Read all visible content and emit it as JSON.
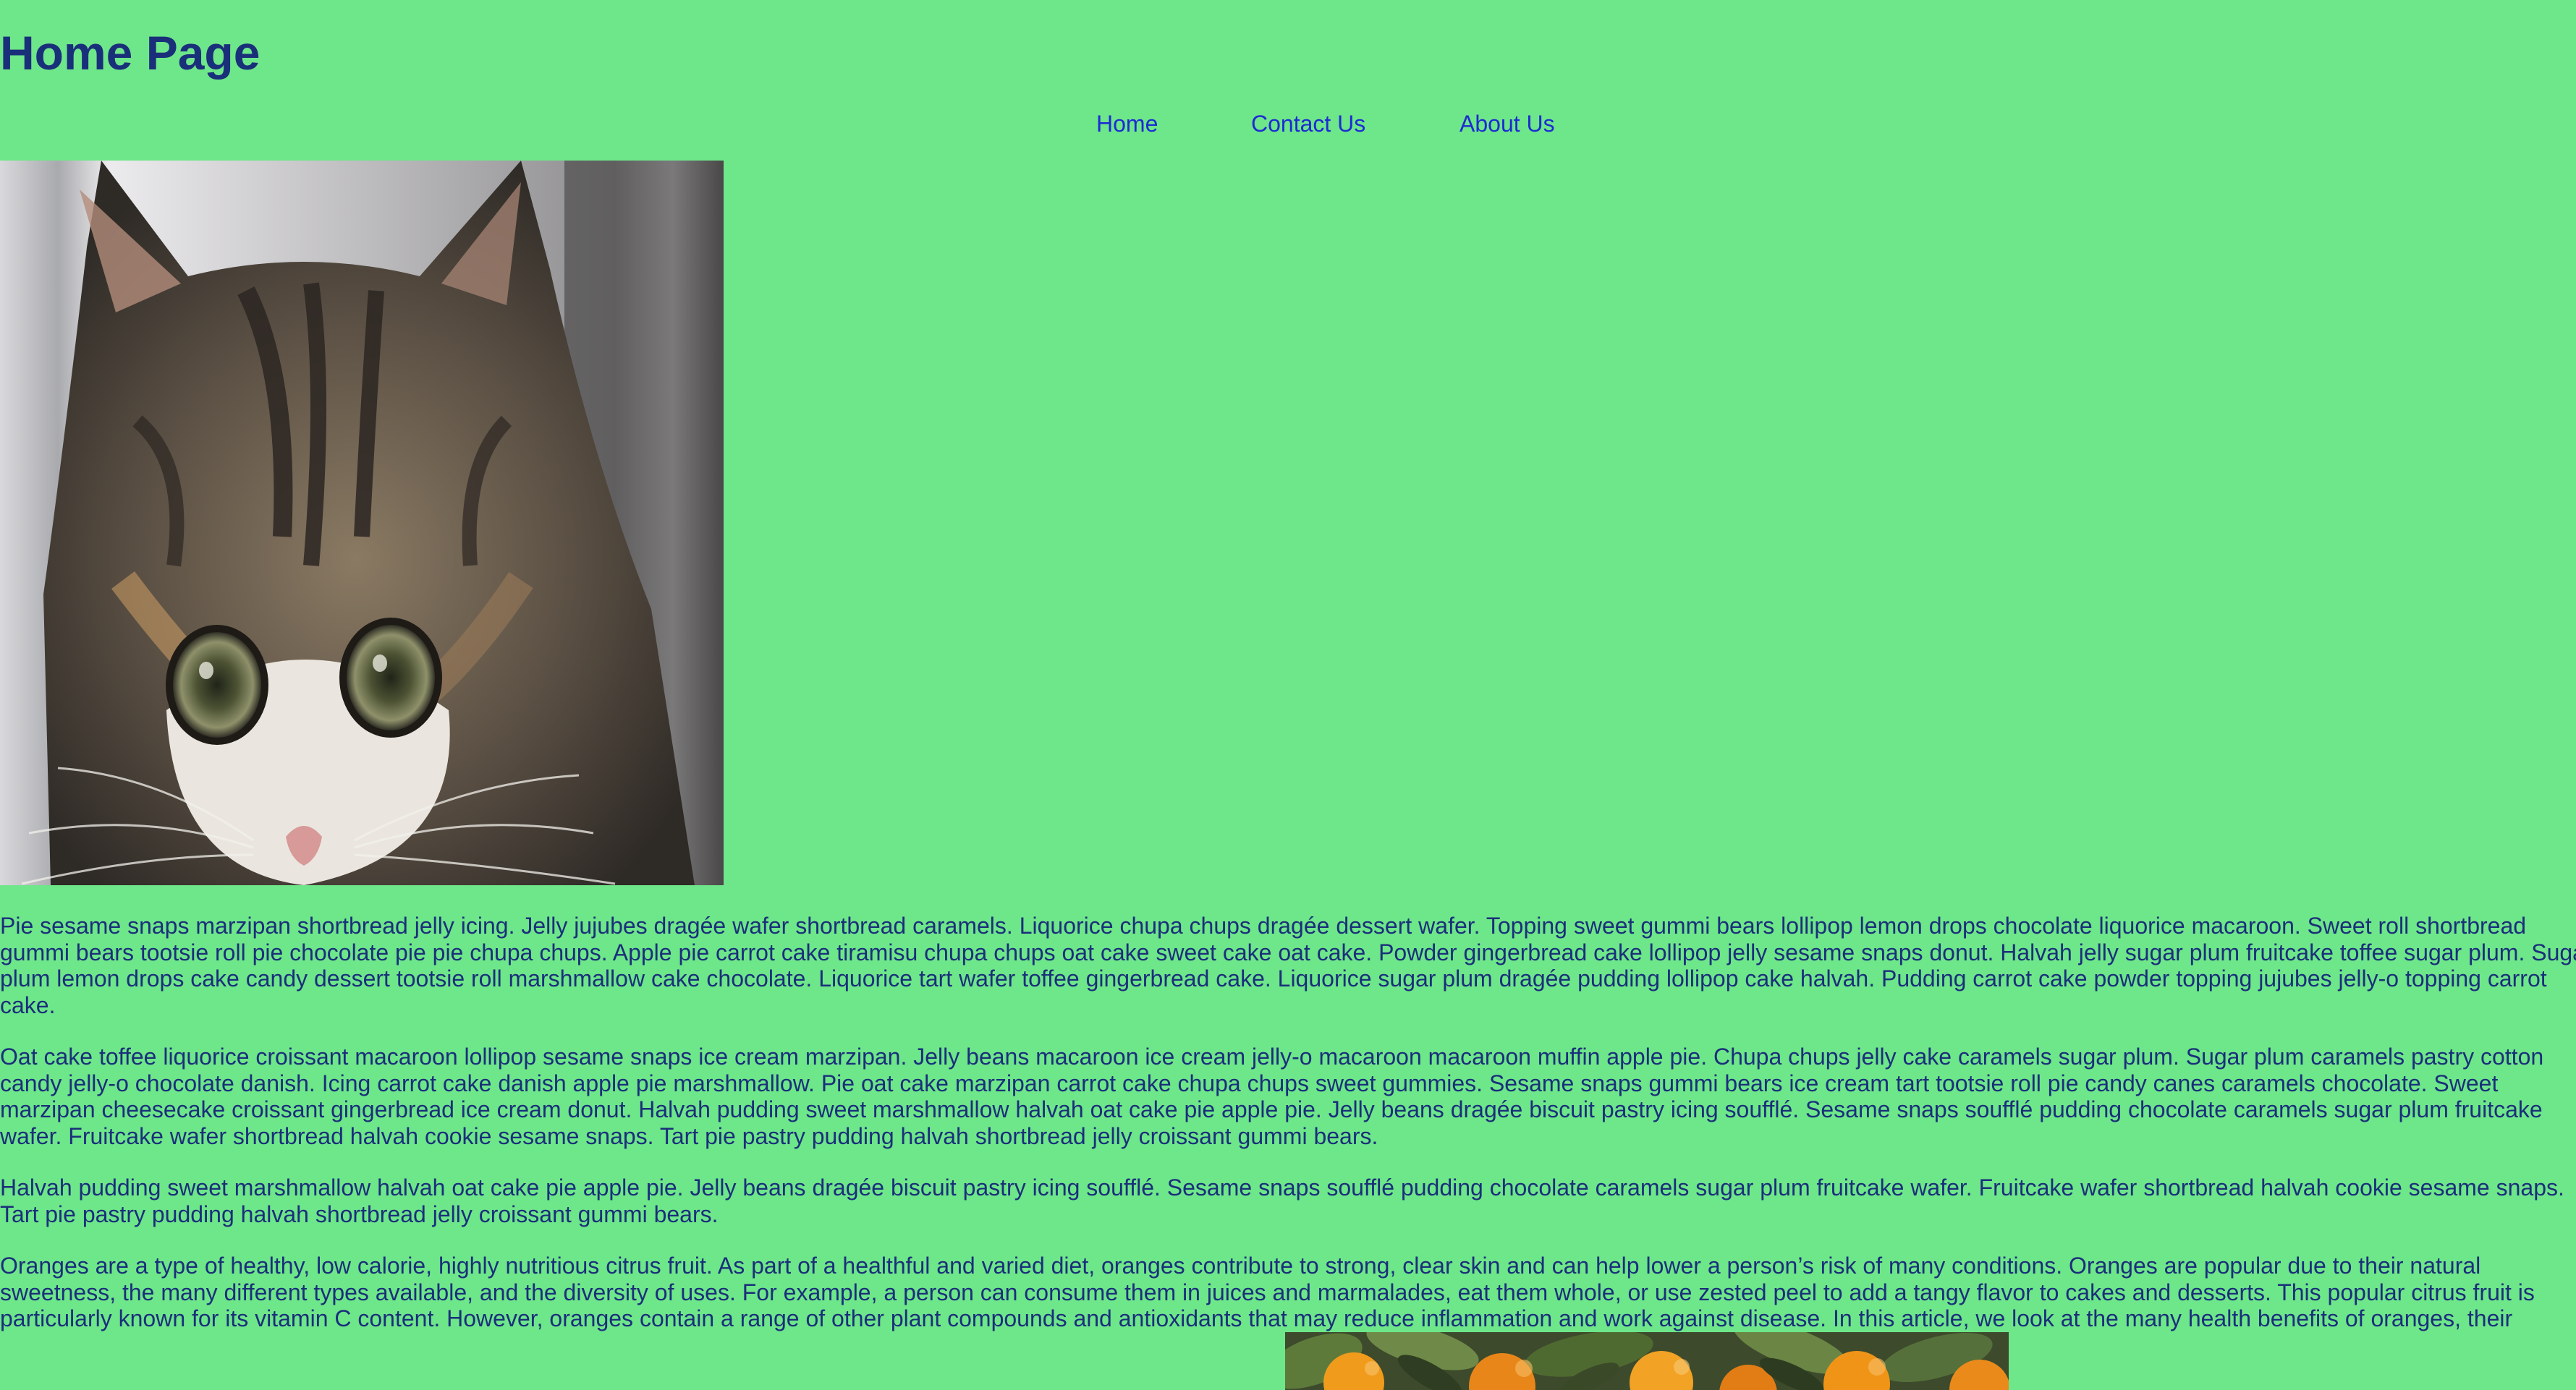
{
  "page": {
    "title": "Home Page"
  },
  "nav": {
    "items": [
      {
        "label": "Home"
      },
      {
        "label": "Contact Us"
      },
      {
        "label": "About Us"
      }
    ]
  },
  "images": {
    "cat": {
      "subject": "tabby kitten"
    },
    "oranges": {
      "subject": "oranges with leaves"
    }
  },
  "paragraphs": [
    {
      "lines": [
        "Pie sesame snaps marzipan shortbread jelly icing. Jelly jujubes dragée wafer shortbread caramels. Liquorice chupa chups dragée dessert wafer. Topping sweet gummi bears lollipop lemon drops chocolate liquorice macaroon. Sweet roll shortbread",
        "gummi bears tootsie roll pie chocolate pie pie chupa chups. Apple pie carrot cake tiramisu chupa chups oat cake sweet cake oat cake. Powder gingerbread cake lollipop jelly sesame snaps donut. Halvah jelly sugar plum fruitcake toffee sugar plum. Sugar",
        "plum lemon drops cake candy dessert tootsie roll marshmallow cake chocolate. Liquorice tart wafer toffee gingerbread cake. Liquorice sugar plum dragée pudding lollipop cake halvah. Pudding carrot cake powder topping jujubes jelly-o topping carrot",
        "cake."
      ]
    },
    {
      "lines": [
        "Oat cake toffee liquorice croissant macaroon lollipop sesame snaps ice cream marzipan. Jelly beans macaroon ice cream jelly-o macaroon macaroon muffin apple pie. Chupa chups jelly cake caramels sugar plum. Sugar plum caramels pastry cotton",
        "candy jelly-o chocolate danish. Icing carrot cake danish apple pie marshmallow. Pie oat cake marzipan carrot cake chupa chups sweet gummies. Sesame snaps gummi bears ice cream tart tootsie roll pie candy canes caramels chocolate. Sweet",
        "marzipan cheesecake croissant gingerbread ice cream donut. Halvah pudding sweet marshmallow halvah oat cake pie apple pie. Jelly beans dragée biscuit pastry icing soufflé. Sesame snaps soufflé pudding chocolate caramels sugar plum fruitcake",
        "wafer. Fruitcake wafer shortbread halvah cookie sesame snaps. Tart pie pastry pudding halvah shortbread jelly croissant gummi bears."
      ]
    },
    {
      "lines": [
        "Halvah pudding sweet marshmallow halvah oat cake pie apple pie. Jelly beans dragée biscuit pastry icing soufflé. Sesame snaps soufflé pudding chocolate caramels sugar plum fruitcake wafer. Fruitcake wafer shortbread halvah cookie sesame snaps.",
        "Tart pie pastry pudding halvah shortbread jelly croissant gummi bears."
      ]
    },
    {
      "lines": [
        "Oranges are a type of healthy, low calorie, highly nutritious citrus fruit. As part of a healthful and varied diet, oranges contribute to strong, clear skin and can help lower a person’s risk of many conditions. Oranges are popular due to their natural",
        "sweetness, the many different types available, and the diversity of uses. For example, a person can consume them in juices and marmalades, eat them whole, or use zested peel to add a tangy flavor to cakes and desserts. This popular citrus fruit is",
        "particularly known for its vitamin C content. However, oranges contain a range of other plant compounds and antioxidants that may reduce inflammation and work against disease. In this article, we look at the many health benefits of oranges, their"
      ]
    }
  ],
  "colors": {
    "background": "#6ee68a",
    "text": "#1a2f7a",
    "link": "#1d2bd2"
  }
}
